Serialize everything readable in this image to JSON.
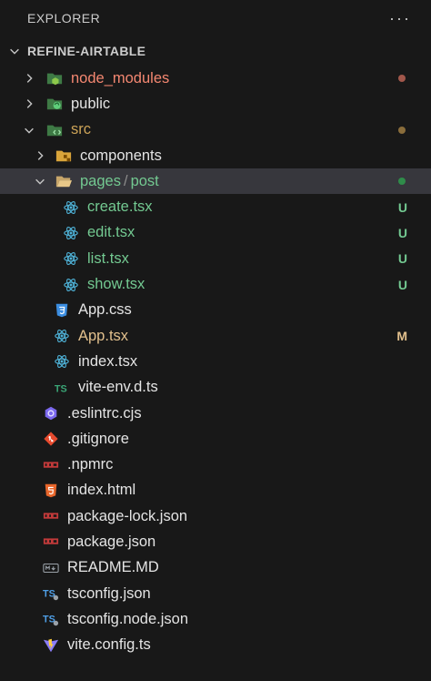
{
  "explorer": {
    "title": "EXPLORER",
    "more": "···"
  },
  "root": {
    "name": "REFINE-AIRTABLE"
  },
  "items": {
    "node_modules": {
      "label": "node_modules"
    },
    "public": {
      "label": "public"
    },
    "src": {
      "label": "src"
    },
    "components": {
      "label": "components"
    },
    "pages": {
      "label": "pages",
      "sep": "/",
      "label2": "post"
    },
    "create": {
      "label": "create.tsx",
      "status": "U"
    },
    "edit": {
      "label": "edit.tsx",
      "status": "U"
    },
    "list": {
      "label": "list.tsx",
      "status": "U"
    },
    "show": {
      "label": "show.tsx",
      "status": "U"
    },
    "appcss": {
      "label": "App.css"
    },
    "apptsx": {
      "label": "App.tsx",
      "status": "M"
    },
    "indextsx": {
      "label": "index.tsx"
    },
    "viteenv": {
      "label": "vite-env.d.ts"
    },
    "eslintrc": {
      "label": ".eslintrc.cjs"
    },
    "gitignore": {
      "label": ".gitignore"
    },
    "npmrc": {
      "label": ".npmrc"
    },
    "indexhtml": {
      "label": "index.html"
    },
    "pkglock": {
      "label": "package-lock.json"
    },
    "pkg": {
      "label": "package.json"
    },
    "readme": {
      "label": "README.MD"
    },
    "tsconfig": {
      "label": "tsconfig.json"
    },
    "tsconfignode": {
      "label": "tsconfig.node.json"
    },
    "viteconfig": {
      "label": "vite.config.ts"
    }
  },
  "colors": {
    "background": "#181818",
    "selected": "#37373d",
    "untracked": "#73c991",
    "modified": "#e2c08d",
    "error_dot": "#a1574b",
    "warn_dot": "#8a6d3b",
    "green_dot": "#2f8c4a"
  }
}
